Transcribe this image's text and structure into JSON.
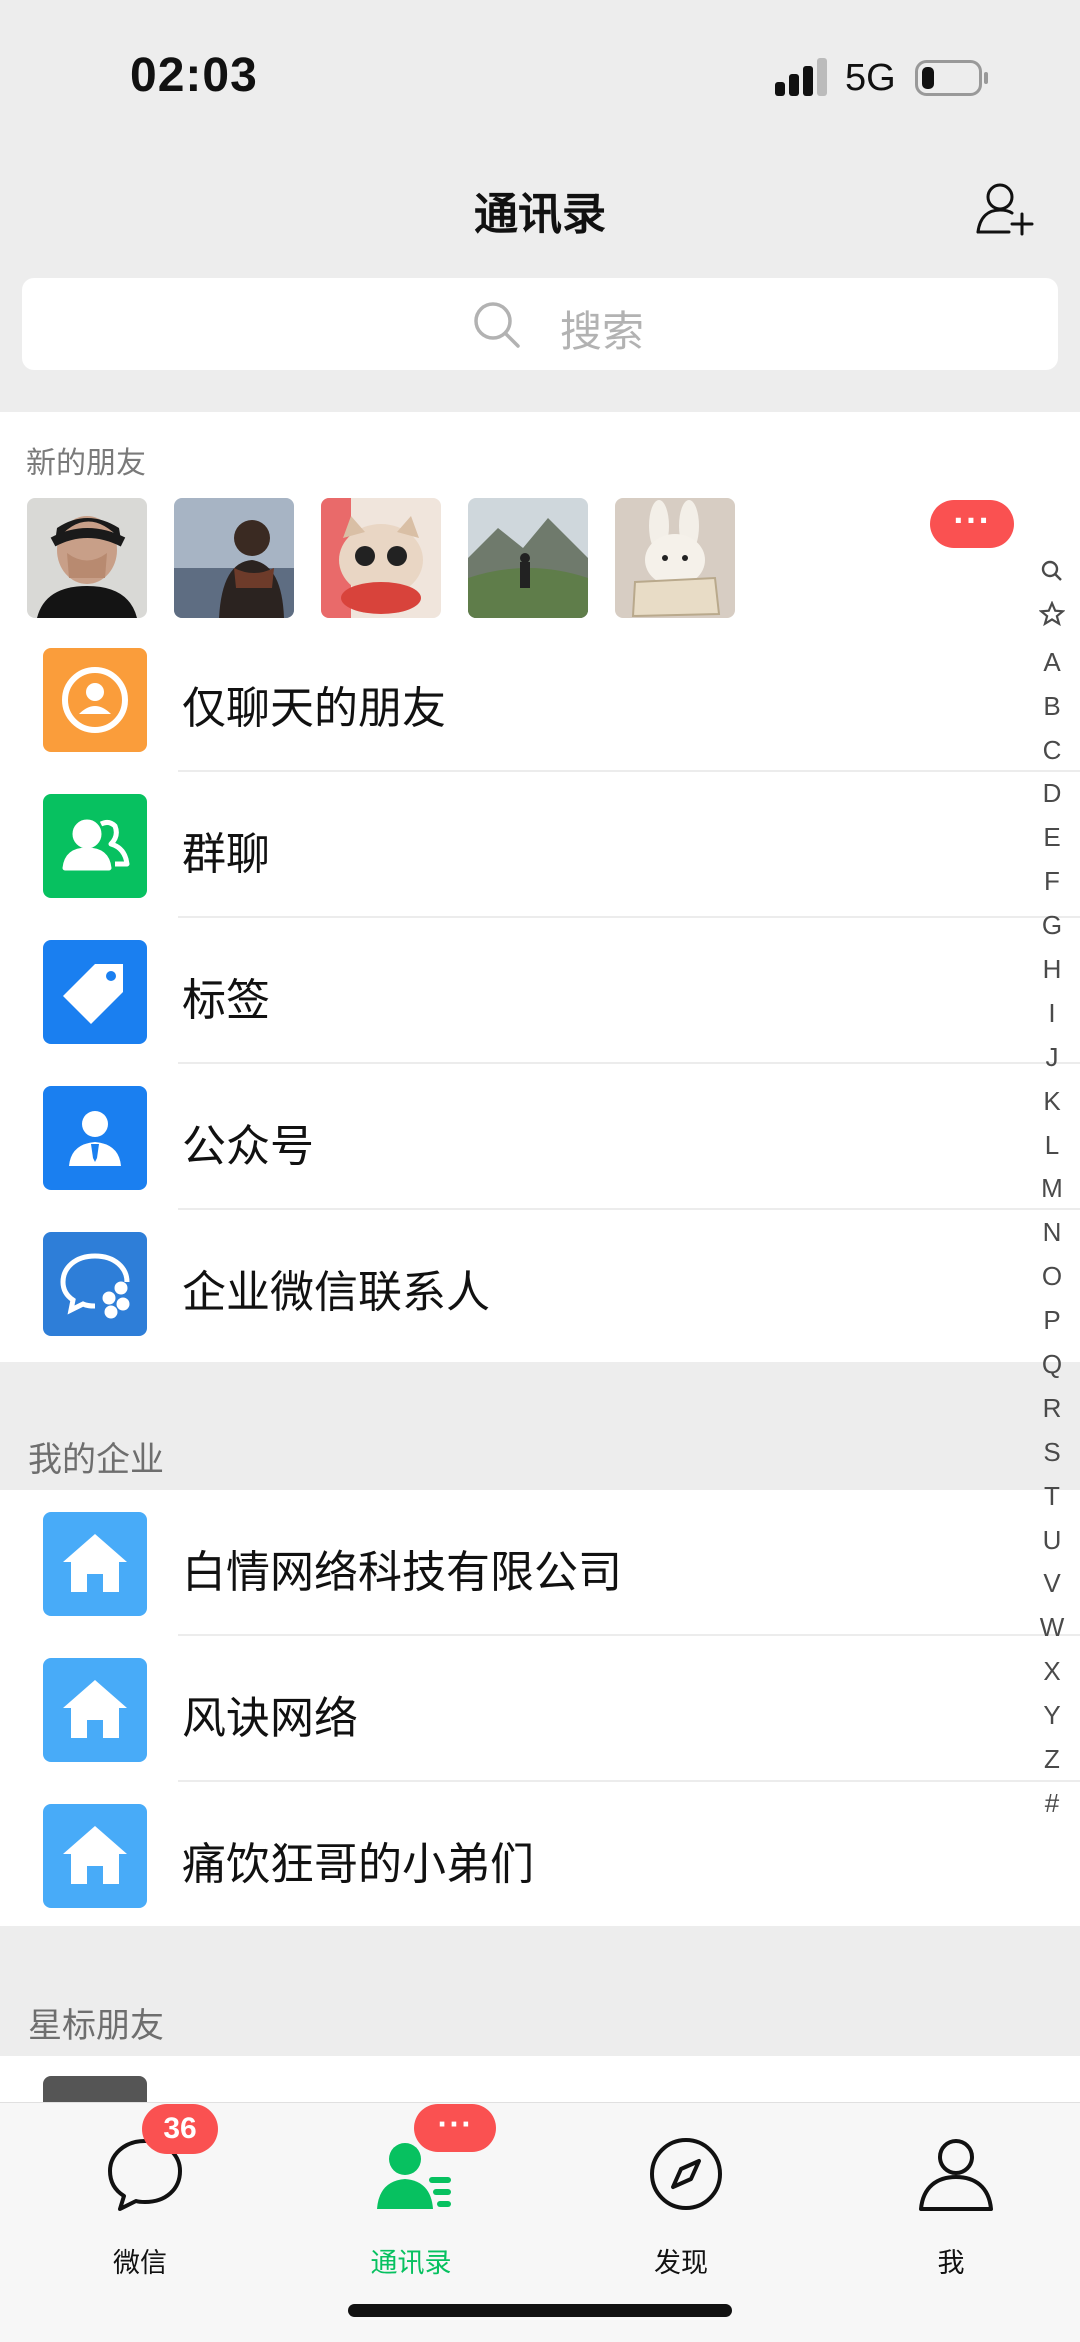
{
  "status_bar": {
    "time": "02:03",
    "network": "5G"
  },
  "header": {
    "title": "通讯录"
  },
  "search": {
    "placeholder": "搜索"
  },
  "new_friends": {
    "label": "新的朋友",
    "more_badge": "···"
  },
  "menu": [
    {
      "label": "仅聊天的朋友",
      "color": "#fa9d3b",
      "icon": "chat-only-friends-icon"
    },
    {
      "label": "群聊",
      "color": "#07c160",
      "icon": "group-chat-icon"
    },
    {
      "label": "标签",
      "color": "#1a7ff0",
      "icon": "tag-icon"
    },
    {
      "label": "公众号",
      "color": "#1a7ff0",
      "icon": "official-account-icon"
    },
    {
      "label": "企业微信联系人",
      "color": "#2e7ed8",
      "icon": "wecom-contact-icon"
    }
  ],
  "companies": {
    "header": "我的企业",
    "items": [
      {
        "label": "白情网络科技有限公司",
        "color": "#48abf8",
        "icon": "company-house-icon"
      },
      {
        "label": "风诀网络",
        "color": "#48abf8",
        "icon": "company-house-icon"
      },
      {
        "label": "痛饮狂哥的小弟们",
        "color": "#48abf8",
        "icon": "company-house-icon"
      }
    ]
  },
  "starred": {
    "header": "星标朋友"
  },
  "index_bar": [
    "search-icon",
    "star-icon",
    "A",
    "B",
    "C",
    "D",
    "E",
    "F",
    "G",
    "H",
    "I",
    "J",
    "K",
    "L",
    "M",
    "N",
    "O",
    "P",
    "Q",
    "R",
    "S",
    "T",
    "U",
    "V",
    "W",
    "X",
    "Y",
    "Z",
    "#"
  ],
  "tabs": [
    {
      "label": "微信",
      "badge": "36",
      "active": false
    },
    {
      "label": "通讯录",
      "badge": "···",
      "active": true
    },
    {
      "label": "发现",
      "active": false
    },
    {
      "label": "我",
      "active": false
    }
  ],
  "colors": {
    "accent": "#07c160",
    "badge": "#fa5151",
    "background": "#ededed"
  }
}
